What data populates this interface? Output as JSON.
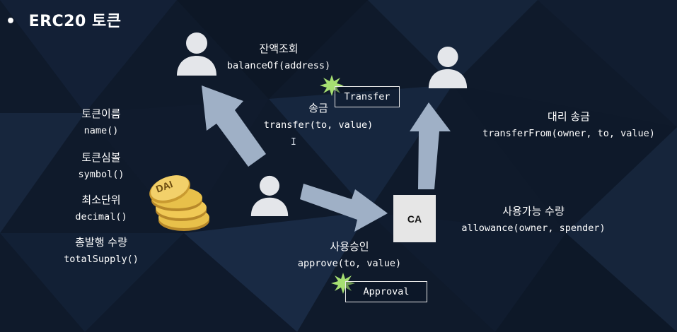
{
  "slide": {
    "bullet": "•",
    "title": "ERC20 토큰"
  },
  "token_info": [
    {
      "label": "토큰이름",
      "func": "name()"
    },
    {
      "label": "토큰심볼",
      "func": "symbol()"
    },
    {
      "label": "최소단위",
      "func": "decimal()"
    },
    {
      "label": "총발행 수량",
      "func": "totalSupply()"
    }
  ],
  "coin": {
    "label": "DAI"
  },
  "balance": {
    "label": "잔액조회",
    "func": "balanceOf(address)"
  },
  "transfer": {
    "label": "송금",
    "func": "transfer(to, value)",
    "event": "Transfer"
  },
  "transfer_from": {
    "label": "대리 송금",
    "func": "transferFrom(owner, to, value)"
  },
  "allowance": {
    "label": "사용가능 수량",
    "func": "allowance(owner, spender)"
  },
  "approve": {
    "label": "사용승인",
    "func": "approve(to, value)",
    "event": "Approval"
  },
  "contract": {
    "label": "CA"
  },
  "cursor_glyph": "I",
  "colors": {
    "background": "#0f1a2b",
    "arrow": "#9fb0c6",
    "person": "#e4e6ea",
    "coin": "#e8c04a",
    "burst": "#a6df72"
  }
}
